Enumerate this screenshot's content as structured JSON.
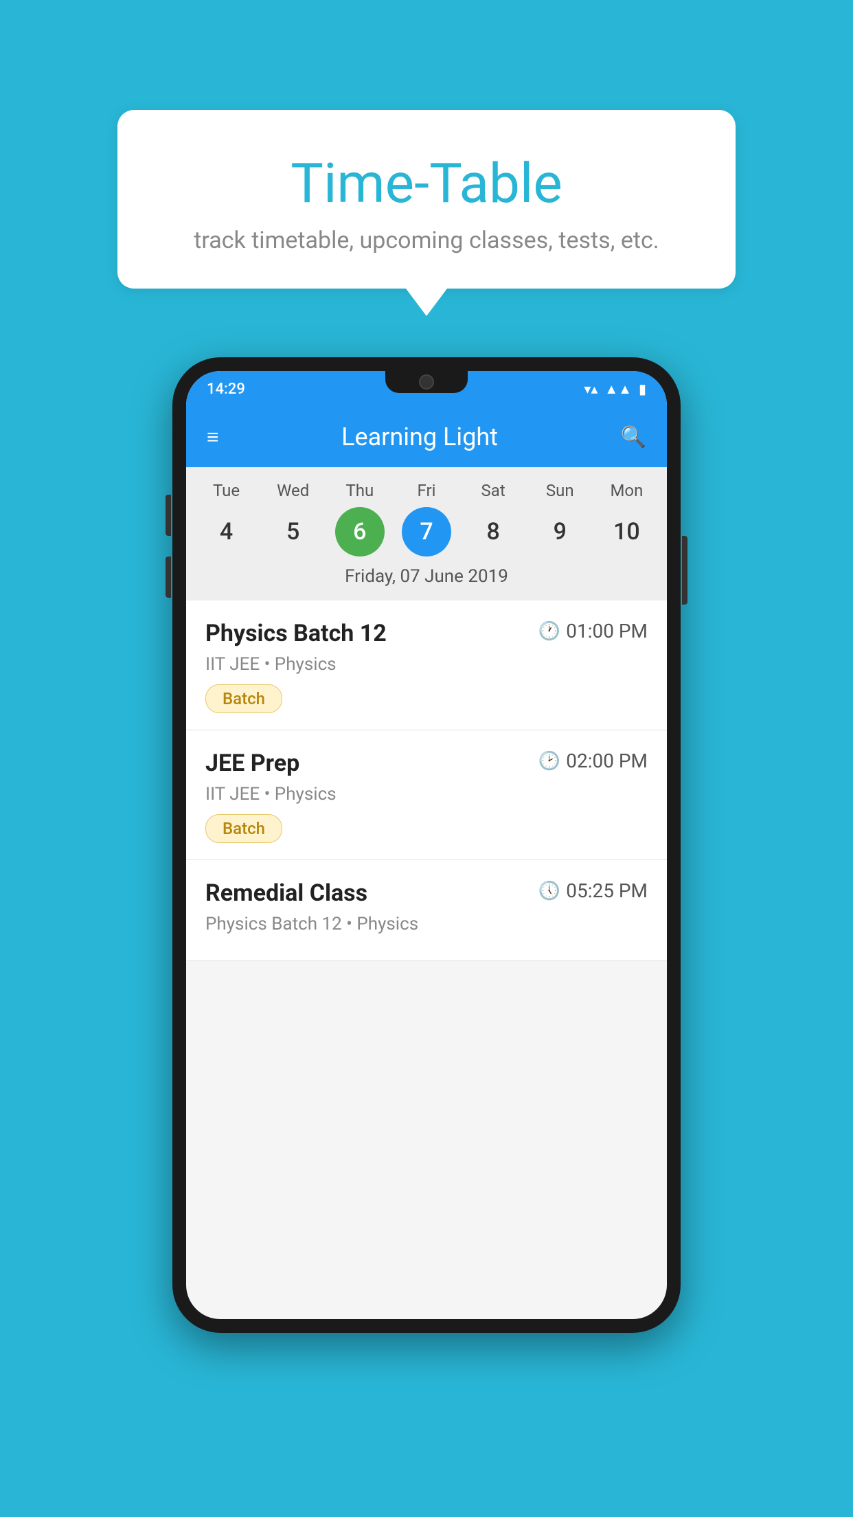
{
  "background_color": "#29B6D6",
  "bubble": {
    "title": "Time-Table",
    "subtitle": "track timetable, upcoming classes, tests, etc."
  },
  "phone": {
    "status_bar": {
      "time": "14:29",
      "icons": [
        "wifi",
        "signal",
        "battery"
      ]
    },
    "app_bar": {
      "title": "Learning Light",
      "menu_icon": "≡",
      "search_icon": "🔍"
    },
    "calendar": {
      "days": [
        {
          "name": "Tue",
          "num": "4",
          "state": "normal"
        },
        {
          "name": "Wed",
          "num": "5",
          "state": "normal"
        },
        {
          "name": "Thu",
          "num": "6",
          "state": "today"
        },
        {
          "name": "Fri",
          "num": "7",
          "state": "selected"
        },
        {
          "name": "Sat",
          "num": "8",
          "state": "normal"
        },
        {
          "name": "Sun",
          "num": "9",
          "state": "normal"
        },
        {
          "name": "Mon",
          "num": "10",
          "state": "normal"
        }
      ],
      "selected_date_label": "Friday, 07 June 2019"
    },
    "events": [
      {
        "name": "Physics Batch 12",
        "time": "01:00 PM",
        "meta": "IIT JEE • Physics",
        "tag": "Batch"
      },
      {
        "name": "JEE Prep",
        "time": "02:00 PM",
        "meta": "IIT JEE • Physics",
        "tag": "Batch"
      },
      {
        "name": "Remedial Class",
        "time": "05:25 PM",
        "meta": "Physics Batch 12 • Physics",
        "tag": ""
      }
    ]
  }
}
